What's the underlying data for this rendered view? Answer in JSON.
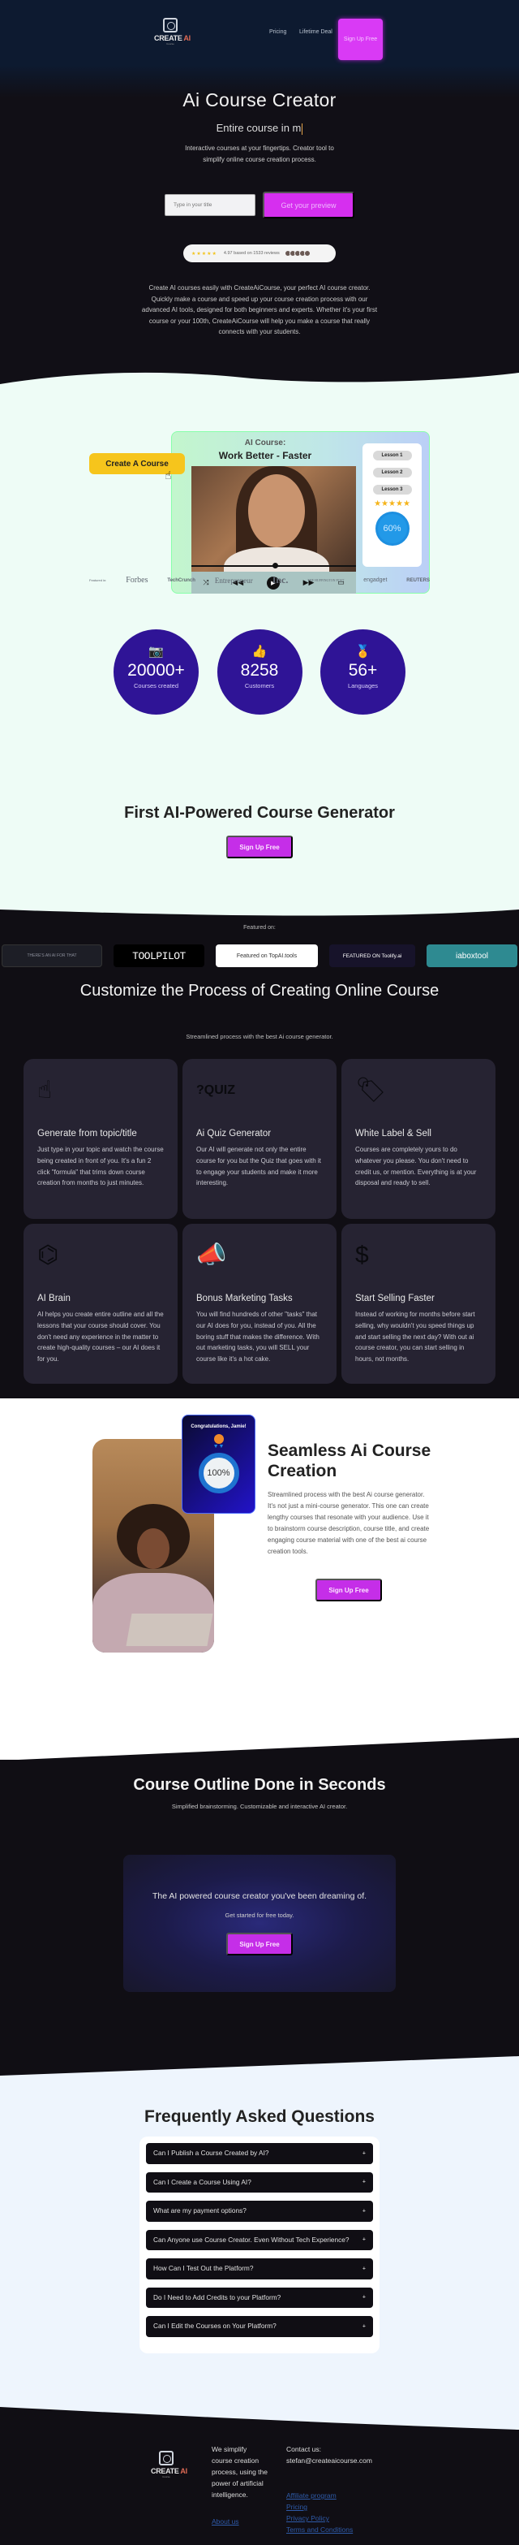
{
  "header": {
    "logo_text": "CREATE",
    "logo_accent": "AI",
    "logo_sub": "Course",
    "nav": [
      "Pricing",
      "Lifetime Deal"
    ],
    "signup_label": "Sign Up Free"
  },
  "hero": {
    "title": "Ai Course Creator",
    "typed_text": "Entire course in m",
    "subtitle": "Interactive courses at your fingertips. Creator tool to simplify online course creation process.",
    "input_placeholder": "Type in your title",
    "input_value": "",
    "cta_label": "Get your preview",
    "rating_stars": "★★★★★",
    "rating_text": "4.97 based on 1533 reviews",
    "description": "Create AI courses easily with CreateAiCourse, your perfect AI course creator. Quickly make a course and speed up your course creation process with our advanced AI tools, designed for both beginners and experts. Whether it's your first course or your 100th, CreateAiCourse will help you make a course that really connects with your students."
  },
  "showcase": {
    "card_title_1": "AI Course:",
    "card_title_2": "Work Better - Faster",
    "lessons": [
      "Lesson 1",
      "Lesson 2",
      "Lesson 3"
    ],
    "stars": "★★★★★",
    "progress_label": "60%",
    "progress_value": 0.6,
    "create_button": "Create A Course",
    "press_label": "Featured in:",
    "press": [
      "Forbes",
      "TechCrunch",
      "Entrepreneur",
      "Inc.",
      "THE HUFFINGTON POST",
      "engadget",
      "REUTERS"
    ]
  },
  "stats": [
    {
      "icon": "camera-icon",
      "value": "20000+",
      "label": "Courses created"
    },
    {
      "icon": "thumbs-up-icon",
      "value": "8258",
      "label": "Customers"
    },
    {
      "icon": "award-icon",
      "value": "56+",
      "label": "Languages"
    }
  ],
  "generator": {
    "title": "First AI-Powered Course Generator",
    "button": "Sign Up Free"
  },
  "featured": {
    "label": "Featured on:",
    "badges": [
      "THERE'S AN AI FOR THAT",
      "TOOLPILOT",
      "Featured on TopAI.tools",
      "FEATURED ON Toolify.ai",
      "iaboxtool"
    ]
  },
  "features": {
    "title": "Customize the Process of Creating Online Course",
    "subtitle": "Streamlined process with the best Ai course generator.",
    "cards": [
      {
        "icon": "tap-hand-icon",
        "title": "Generate from topic/title",
        "text": "Just type in your topic and watch the course being created in front of you. It's a fun 2 click \"formula\" that trims down course creation from months to just minutes."
      },
      {
        "icon": "quiz-icon",
        "title": "Ai Quiz Generator",
        "text": "Our AI will generate not only the entire course for you but the Quiz that goes with it to engage your students and make it more interesting."
      },
      {
        "icon": "price-tag-icon",
        "title": "White Label & Sell",
        "text": "Courses are completely yours to do whatever you please. You don't need to credit us, or mention. Everything is at your disposal and ready to sell."
      },
      {
        "icon": "brain-icon",
        "title": "AI Brain",
        "text": "AI helps you create entire outline and all the lessons that your course should cover. You don't need any experience in the matter to create high-quality courses – our AI does it for you."
      },
      {
        "icon": "megaphone-icon",
        "title": "Bonus Marketing Tasks",
        "text": "You will find hundreds of other \"tasks\" that our AI does for you, instead of you. All the boring stuff that makes the difference. With out marketing tasks, you will SELL your course like it's a hot cake."
      },
      {
        "icon": "dollar-icon",
        "title": "Start Selling Faster",
        "text": "Instead of working for months before start selling, why wouldn't you speed things up and start selling the next day? With out ai course creator, you can start selling in hours, not months."
      }
    ]
  },
  "seamless": {
    "badge_title": "Congratulations, Jamie!",
    "badge_value": "100%",
    "title": "Seamless Ai Course Creation",
    "text": "Streamlined process with the best Ai course generator. It's not just a mini-course generator. This one can create lengthy courses that resonate with your audience. Use it to brainstorm course description, course title, and create engaging course material with one of the best ai course creation tools.",
    "button": "Sign Up Free"
  },
  "outline": {
    "title": "Course Outline Done in Seconds",
    "subtitle": "Simplified brainstorming. Customizable and interactive AI creator.",
    "box_title": "The AI powered course creator you've been dreaming of.",
    "box_sub": "Get started for free today.",
    "button": "Sign Up Free"
  },
  "faq": {
    "title": "Frequently Asked Questions",
    "items": [
      "Can I Publish a Course Created by AI?",
      "Can I Create a Course Using AI?",
      "What are my payment options?",
      "Can Anyone use Course Creator. Even Without Tech Experience?",
      "How Can I Test Out the Platform?",
      "Do I Need to Add Credits to your Platform?",
      "Can I Edit the Courses on Your Platform?"
    ],
    "toggle": "+"
  },
  "footer": {
    "about": "We simplify course creation process, using the power of artificial intelligence.",
    "about_link": "About us",
    "contact_label": "Contact us:",
    "email": "stefan@createaicourse.com",
    "links": [
      "Affiliate program",
      "Pricing",
      "Privacy Policy",
      "Terms and Conditions"
    ]
  },
  "colors": {
    "accent": "#d62fef",
    "stat_circle": "#2f1496",
    "dark_bg": "#100e14",
    "mint_bg": "#eefcf6"
  }
}
